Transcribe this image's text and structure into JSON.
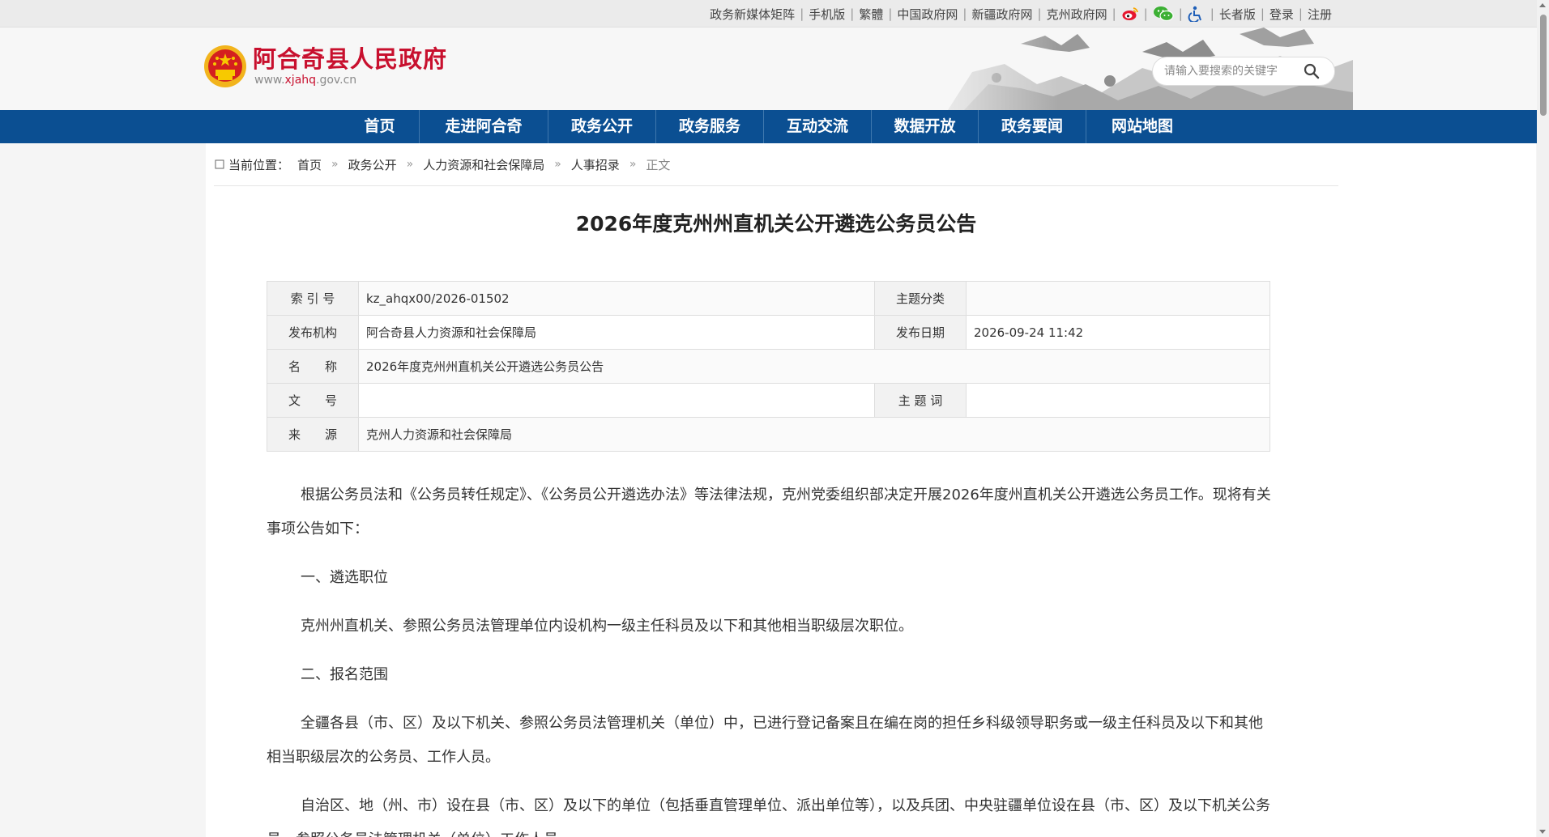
{
  "topbar": {
    "links": [
      "政务新媒体矩阵",
      "手机版",
      "繁體",
      "中国政府网",
      "新疆政府网",
      "克州政府网"
    ],
    "icons": [
      "weibo-icon",
      "wechat-icon",
      "accessibility-icon"
    ],
    "links_after": [
      "长者版",
      "登录",
      "注册"
    ]
  },
  "header": {
    "site_title": "阿合奇县人民政府",
    "site_url_prefix": "www.",
    "site_url_domain": "xjahq",
    "site_url_suffix": ".gov.cn",
    "search_placeholder": "请输入要搜索的关键字"
  },
  "nav": {
    "items": [
      "首页",
      "走进阿合奇",
      "政务公开",
      "政务服务",
      "互动交流",
      "数据开放",
      "政务要闻",
      "网站地图"
    ]
  },
  "breadcrumb": {
    "label": "当前位置：",
    "items": [
      "首页",
      "政务公开",
      "人力资源和社会保障局",
      "人事招录"
    ],
    "sep": "»",
    "current": "正文"
  },
  "article": {
    "title": "2026年度克州州直机关公开遴选公务员公告",
    "meta": {
      "index_label": "索 引 号",
      "index_value": "kz_ahqx00/2026-01502",
      "category_label": "主题分类",
      "category_value": "",
      "publisher_label": "发布机构",
      "publisher_value": "阿合奇县人力资源和社会保障局",
      "date_label": "发布日期",
      "date_value": "2026-09-24 11:42",
      "name_label": "名　　称",
      "name_value": "2026年度克州州直机关公开遴选公务员公告",
      "docno_label": "文　　号",
      "docno_value": "",
      "keyword_label": "主 题 词",
      "keyword_value": "",
      "source_label": "来　　源",
      "source_value": "克州人力资源和社会保障局"
    },
    "paragraphs": [
      "根据公务员法和《公务员转任规定》、《公务员公开遴选办法》等法律法规，克州党委组织部决定开展2026年度州直机关公开遴选公务员工作。现将有关事项公告如下：",
      "一、遴选职位",
      "克州州直机关、参照公务员法管理单位内设机构一级主任科员及以下和其他相当职级层次职位。",
      "二、报名范围",
      "全疆各县（市、区）及以下机关、参照公务员法管理机关（单位）中，已进行登记备案且在编在岗的担任乡科级领导职务或一级主任科员及以下和其他相当职级层次的公务员、工作人员。",
      "自治区、地（州、市）设在县（市、区）及以下的单位（包括垂直管理单位、派出单位等），以及兵团、中央驻疆单位设在县（市、区）及以下机关公务员、参照公务员法管理机关（单位）工作人员。"
    ]
  },
  "colors": {
    "nav_bg": "#0b4f92",
    "title_red": "#c8102e"
  }
}
